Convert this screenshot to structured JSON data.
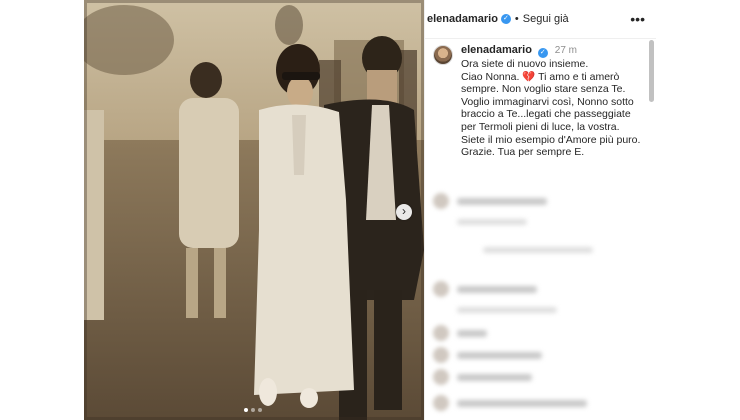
{
  "post": {
    "username": "elenadamario",
    "follow_label": "Segui già",
    "separator": "•",
    "more_label": "•••",
    "verified_glyph": "✓"
  },
  "caption": {
    "username": "elenadamario",
    "time": "27 m",
    "lines": [
      "Ora siete di nuovo insieme.",
      "Ciao Nonna. 💔 Ti amo e ti amerò",
      "sempre. Non voglio stare senza Te.",
      "Voglio immaginarvi così, Nonno sotto",
      "braccio a Te...legati che passeggiate",
      "per Termoli pieni di luce, la vostra.",
      "Siete il mio esempio d'Amore più puro.",
      "Grazie. Tua per sempre E."
    ]
  },
  "media": {
    "next_glyph": "›",
    "carousel_count": 3,
    "carousel_active": 1
  },
  "colors": {
    "verified": "#3897f0",
    "text": "#262626",
    "muted": "#8e8e8e",
    "photo_sepia": "#7b6a52"
  }
}
